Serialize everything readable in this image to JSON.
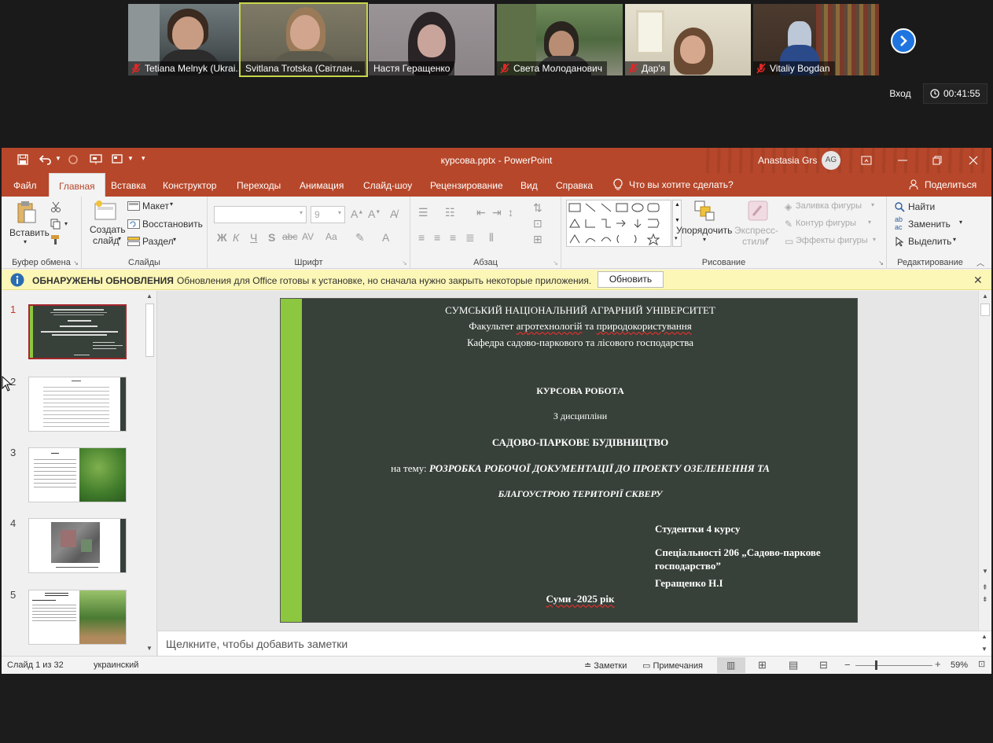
{
  "zoom": {
    "participants": [
      {
        "name": "Tetiana Melnyk (Ukrai...",
        "muted": true
      },
      {
        "name": "Svitlana Trotska (Світлан...",
        "muted": false,
        "active": true
      },
      {
        "name": "Настя Геращенко",
        "muted": false
      },
      {
        "name": "Света Молоданович",
        "muted": true
      },
      {
        "name": "Дар'я",
        "muted": true
      },
      {
        "name": "Vitaliy Bogdan",
        "muted": true
      }
    ],
    "sign_in_label": "Вход",
    "timer": "00:41:55"
  },
  "ppt": {
    "doc_title": "курсова.pptx  -  PowerPoint",
    "user_name": "Anastasia Grs",
    "avatar_initials": "AG",
    "tabs": [
      "Файл",
      "Главная",
      "Вставка",
      "Конструктор",
      "Переходы",
      "Анимация",
      "Слайд-шоу",
      "Рецензирование",
      "Вид",
      "Справка"
    ],
    "tell_me": "Что вы хотите сделать?",
    "share": "Поделиться",
    "ribbon": {
      "clipboard": {
        "paste": "Вставить",
        "label": "Буфер обмена"
      },
      "slides": {
        "new_slide_1": "Создать",
        "new_slide_2": "слайд",
        "layout": "Макет",
        "reset": "Восстановить",
        "section": "Раздел",
        "label": "Слайды"
      },
      "font": {
        "size": "9",
        "label": "Шрифт",
        "bold": "Ж",
        "italic": "К",
        "underline": "Ч",
        "shadow": "S",
        "strike": "abc",
        "spacing": "AV",
        "case": "Aa"
      },
      "paragraph": {
        "label": "Абзац"
      },
      "drawing": {
        "arrange": "Упорядочить",
        "styles_1": "Экспресс-",
        "styles_2": "стили",
        "fill": "Заливка фигуры",
        "outline": "Контур фигуры",
        "effects": "Эффекты фигуры",
        "label": "Рисование"
      },
      "editing": {
        "find": "Найти",
        "replace": "Заменить",
        "select": "Выделить",
        "label": "Редактирование"
      }
    },
    "update_bar": {
      "title": "ОБНАРУЖЕНЫ ОБНОВЛЕНИЯ",
      "message": "Обновления для Office готовы к установке, но сначала нужно закрыть некоторые приложения.",
      "button": "Обновить"
    },
    "slide_numbers": [
      "1",
      "2",
      "3",
      "4",
      "5"
    ],
    "slide": {
      "university": "СУМСЬКИЙ НАЦІОНАЛЬНИЙ АГРАРНИЙ УНІВЕРСИТЕТ",
      "faculty_pre": "Факультет ",
      "faculty_w1": "агротехнологій",
      "faculty_mid": " та ",
      "faculty_w2": "природокористування",
      "department": "Кафедра садово-паркового та лісового господарства",
      "work_type": "КУРСОВА РОБОТА",
      "discipline_pre": "З дисципліни",
      "discipline": "САДОВО-ПАРКОВЕ БУДІВНИЦТВО",
      "topic_pre": "на тему: ",
      "topic_1": "РОЗРОБКА РОБОЧОЇ ДОКУМЕНТАЦІЇ ДО ПРОЕКТУ ОЗЕЛЕНЕННЯ ТА",
      "topic_2": "БЛАГОУСТРОЮ ТЕРИТОРІЇ СКВЕРУ",
      "student": "Студентки 4 курсу",
      "specialty_1": "Спеціальності 206 „Садово-паркове",
      "specialty_2": "господарство”",
      "author": "Геращенко Н.І",
      "city_year": "Суми -2025 рік"
    },
    "notes_placeholder": "Щелкните, чтобы добавить заметки",
    "status": {
      "slide_info": "Слайд 1 из 32",
      "language": "украинский",
      "notes": "Заметки",
      "comments": "Примечания",
      "zoom": "59%"
    }
  }
}
